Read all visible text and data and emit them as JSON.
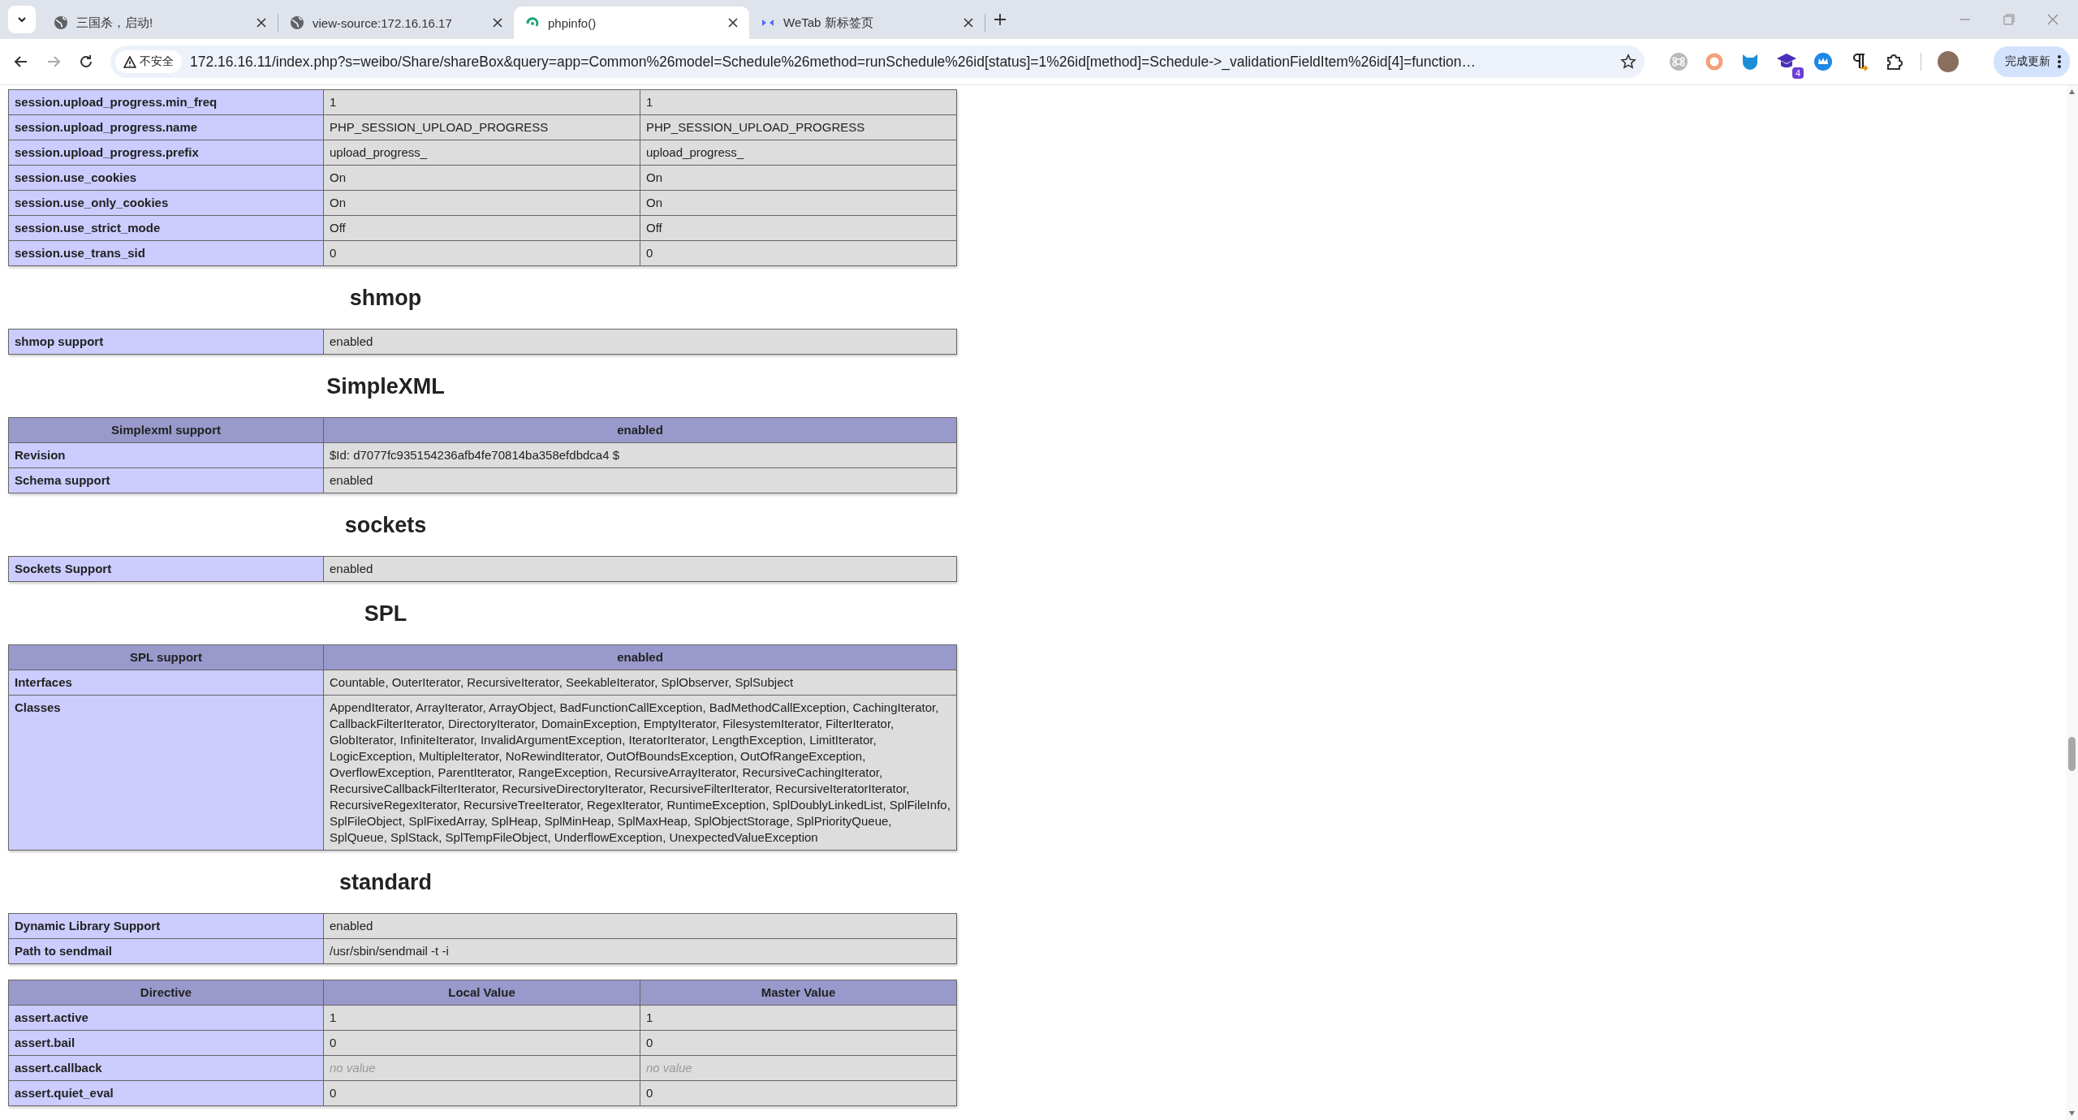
{
  "browser": {
    "tabs": [
      {
        "title": "三国杀，启动!",
        "selected": false
      },
      {
        "title": "view-source:172.16.16.17",
        "selected": false
      },
      {
        "title": "phpinfo()",
        "selected": true
      },
      {
        "title": "WeTab 新标签页",
        "selected": false
      }
    ],
    "address_bar": {
      "security_label": "不安全",
      "url": "172.16.16.11/index.php?s=weibo/Share/shareBox&query=app=Common%26model=Schedule%26method=runSchedule%26id[status]=1%26id[method]=Schedule->_validationFieldItem%26id[4]=function…"
    },
    "extension_badge": "4",
    "update_button": "完成更新"
  },
  "page": {
    "sections": [
      {
        "kind": "table",
        "rows": [
          {
            "kind": "data",
            "label": "session.upload_progress.min_freq",
            "values": [
              "1",
              "1"
            ]
          },
          {
            "kind": "data",
            "label": "session.upload_progress.name",
            "values": [
              "PHP_SESSION_UPLOAD_PROGRESS",
              "PHP_SESSION_UPLOAD_PROGRESS"
            ]
          },
          {
            "kind": "data",
            "label": "session.upload_progress.prefix",
            "values": [
              "upload_progress_",
              "upload_progress_"
            ]
          },
          {
            "kind": "data",
            "label": "session.use_cookies",
            "values": [
              "On",
              "On"
            ]
          },
          {
            "kind": "data",
            "label": "session.use_only_cookies",
            "values": [
              "On",
              "On"
            ]
          },
          {
            "kind": "data",
            "label": "session.use_strict_mode",
            "values": [
              "Off",
              "Off"
            ]
          },
          {
            "kind": "data",
            "label": "session.use_trans_sid",
            "values": [
              "0",
              "0"
            ]
          }
        ]
      },
      {
        "kind": "heading",
        "text": "shmop"
      },
      {
        "kind": "table",
        "rows": [
          {
            "kind": "data",
            "label": "shmop support",
            "values": [
              "enabled"
            ]
          }
        ]
      },
      {
        "kind": "heading",
        "text": "SimpleXML"
      },
      {
        "kind": "table",
        "rows": [
          {
            "kind": "header",
            "label": "Simplexml support",
            "values": [
              "enabled"
            ]
          },
          {
            "kind": "data",
            "label": "Revision",
            "values": [
              "$Id: d7077fc935154236afb4fe70814ba358efdbdca4 $"
            ]
          },
          {
            "kind": "data",
            "label": "Schema support",
            "values": [
              "enabled"
            ]
          }
        ]
      },
      {
        "kind": "heading",
        "text": "sockets"
      },
      {
        "kind": "table",
        "rows": [
          {
            "kind": "data",
            "label": "Sockets Support",
            "values": [
              "enabled"
            ]
          }
        ]
      },
      {
        "kind": "heading",
        "text": "SPL"
      },
      {
        "kind": "table",
        "rows": [
          {
            "kind": "header",
            "label": "SPL support",
            "values": [
              "enabled"
            ]
          },
          {
            "kind": "data",
            "label": "Interfaces",
            "values": [
              "Countable, OuterIterator, RecursiveIterator, SeekableIterator, SplObserver, SplSubject"
            ]
          },
          {
            "kind": "data",
            "label": "Classes",
            "values": [
              "AppendIterator, ArrayIterator, ArrayObject, BadFunctionCallException, BadMethodCallException, CachingIterator, CallbackFilterIterator, DirectoryIterator, DomainException, EmptyIterator, FilesystemIterator, FilterIterator, GlobIterator, InfiniteIterator, InvalidArgumentException, IteratorIterator, LengthException, LimitIterator, LogicException, MultipleIterator, NoRewindIterator, OutOfBoundsException, OutOfRangeException, OverflowException, ParentIterator, RangeException, RecursiveArrayIterator, RecursiveCachingIterator, RecursiveCallbackFilterIterator, RecursiveDirectoryIterator, RecursiveFilterIterator, RecursiveIteratorIterator, RecursiveRegexIterator, RecursiveTreeIterator, RegexIterator, RuntimeException, SplDoublyLinkedList, SplFileInfo, SplFileObject, SplFixedArray, SplHeap, SplMinHeap, SplMaxHeap, SplObjectStorage, SplPriorityQueue, SplQueue, SplStack, SplTempFileObject, UnderflowException, UnexpectedValueException"
            ]
          }
        ]
      },
      {
        "kind": "heading",
        "text": "standard"
      },
      {
        "kind": "table",
        "rows": [
          {
            "kind": "data",
            "label": "Dynamic Library Support",
            "values": [
              "enabled"
            ]
          },
          {
            "kind": "data",
            "label": "Path to sendmail",
            "values": [
              "/usr/sbin/sendmail -t -i"
            ]
          }
        ]
      },
      {
        "kind": "table",
        "rows": [
          {
            "kind": "header",
            "label": "Directive",
            "values": [
              "Local Value",
              "Master Value"
            ]
          },
          {
            "kind": "data",
            "label": "assert.active",
            "values": [
              "1",
              "1"
            ]
          },
          {
            "kind": "data",
            "label": "assert.bail",
            "values": [
              "0",
              "0"
            ]
          },
          {
            "kind": "novalue",
            "label": "assert.callback",
            "values": [
              "no value",
              "no value"
            ]
          },
          {
            "kind": "data",
            "label": "assert.quiet_eval",
            "values": [
              "0",
              "0"
            ]
          }
        ]
      }
    ]
  }
}
